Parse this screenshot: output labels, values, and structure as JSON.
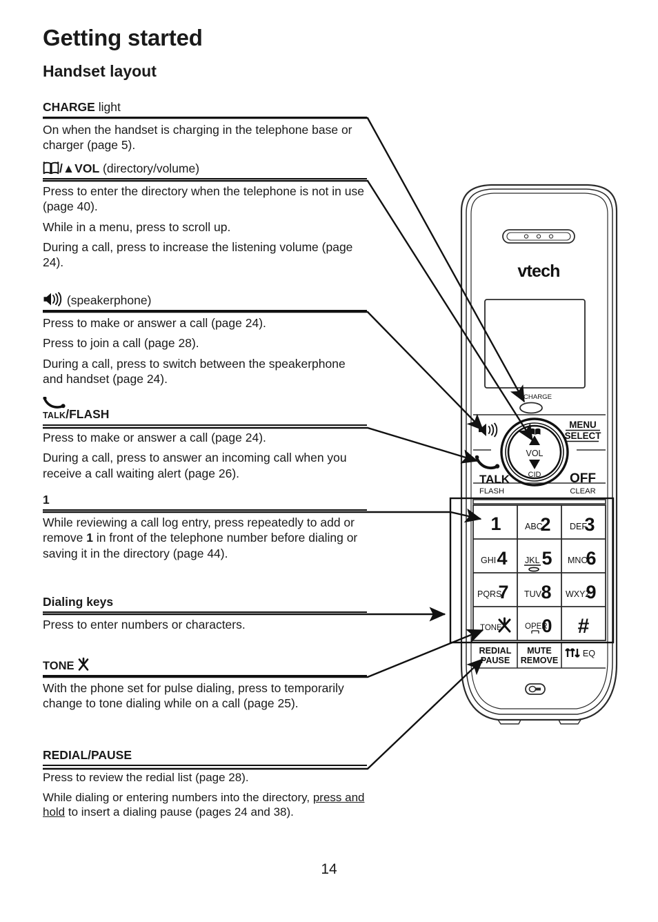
{
  "document": {
    "chapter_title": "Getting started",
    "section_title": "Handset layout",
    "page_number": "14"
  },
  "sections": [
    {
      "id": "charge-light",
      "title_bold": "CHARGE",
      "title_rest": " light",
      "paragraphs": [
        "On when the handset is charging in the telephone base or charger (page 5)."
      ]
    },
    {
      "id": "directory-volume",
      "title_icon": "directory-book-icon",
      "title_bold": "/▲VOL",
      "title_rest": " (directory/volume)",
      "paragraphs": [
        "Press to enter the directory when the telephone is not in use (page 40).",
        "While in a menu, press to scroll up.",
        "During a call, press to increase the listening volume (page 24)."
      ]
    },
    {
      "id": "speakerphone",
      "title_icon": "speakerphone-icon",
      "title_bold": "",
      "title_rest": " (speakerphone)",
      "paragraphs": [
        "Press to make or answer a call (page 24).",
        "Press to join a call (page 28).",
        "During a call, press to switch between the speakerphone and handset (page 24)."
      ]
    },
    {
      "id": "talk-flash",
      "title_icon": "talk-handset-icon",
      "title_smallcaps": "TALK",
      "title_bold": "/FLASH",
      "title_rest": "",
      "paragraphs": [
        "Press to make or answer a call (page 24).",
        "During a call, press to answer an incoming call when you receive a call waiting alert (page 26)."
      ]
    },
    {
      "id": "key-one",
      "title_bold": "1",
      "title_rest": "",
      "paragraphs": [
        "While reviewing a call log entry, press repeatedly to add or remove 1 in front of the telephone number before dialing or saving it in the directory (page 44)."
      ]
    },
    {
      "id": "dialing-keys",
      "title_bold": "Dialing keys",
      "title_rest": "",
      "paragraphs": [
        "Press to enter numbers or characters."
      ]
    },
    {
      "id": "tone",
      "title_bold": "TONE ",
      "title_icon": "tone-star-icon",
      "title_rest": "",
      "paragraphs": [
        "With the phone set for pulse dialing, press to temporarily change to tone dialing while on a call (page 25)."
      ]
    },
    {
      "id": "redial-pause",
      "title_bold": "REDIAL/PAUSE",
      "title_rest": "",
      "paragraphs": [
        "Press to review the redial list (page 28).",
        "While dialing or entering numbers into the directory, press and hold to insert a dialing pause (pages 24 and 38)."
      ]
    }
  ],
  "handset": {
    "brand": "vtech",
    "charge_label": "CHARGE",
    "soft_keys": {
      "menu": "MENU",
      "select": "SELECT",
      "off": "OFF",
      "clear": "CLEAR",
      "talk": "TALK",
      "flash": "FLASH"
    },
    "navigation": {
      "up_label": "VOL",
      "down_label": "CID"
    },
    "keypad": [
      {
        "letters": "",
        "digit": "1"
      },
      {
        "letters": "ABC",
        "digit": "2"
      },
      {
        "letters": "DEF",
        "digit": "3"
      },
      {
        "letters": "GHI",
        "digit": "4"
      },
      {
        "letters": "JKL",
        "digit": "5"
      },
      {
        "letters": "MNO",
        "digit": "6"
      },
      {
        "letters": "PQRS",
        "digit": "7"
      },
      {
        "letters": "TUV",
        "digit": "8"
      },
      {
        "letters": "WXYZ",
        "digit": "9"
      },
      {
        "letters": "TONE",
        "digit": "✳"
      },
      {
        "letters": "OPER",
        "digit": "0"
      },
      {
        "letters": "",
        "digit": "#"
      }
    ],
    "function_row": [
      {
        "line1": "REDIAL",
        "line2": "PAUSE"
      },
      {
        "line1": "MUTE",
        "line2": "REMOVE"
      },
      {
        "line1": "EQ",
        "line2": ""
      }
    ]
  },
  "colors": {
    "ink": "#1a1a1a",
    "line": "#111111",
    "outline": "#2b2b2b",
    "background": "#ffffff"
  }
}
